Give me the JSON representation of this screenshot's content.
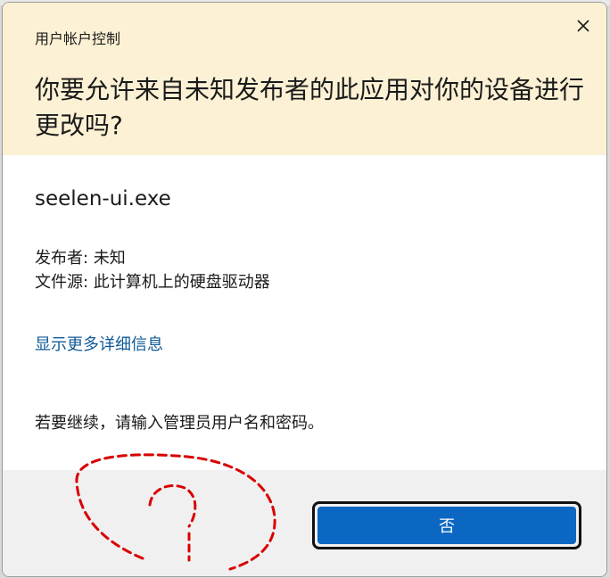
{
  "dialog": {
    "title": "用户帐户控制",
    "headline": "你要允许来自未知发布者的此应用对你的设备进行更改吗?",
    "close_icon": "close-icon"
  },
  "app": {
    "exe_name": "seelen-ui.exe",
    "publisher_line": "发布者: 未知",
    "source_line": "文件源: 此计算机上的硬盘驱动器",
    "details_link": "显示更多详细信息",
    "instruction": "若要继续，请输入管理员用户名和密码。"
  },
  "footer": {
    "no_button_label": "否"
  },
  "annotation": {
    "mark": "?",
    "color": "#d80000"
  },
  "colors": {
    "header_bg": "#fcf1d4",
    "link": "#0f5a96",
    "primary_button": "#0b67c2",
    "footer_bg": "#f0f0f0"
  }
}
